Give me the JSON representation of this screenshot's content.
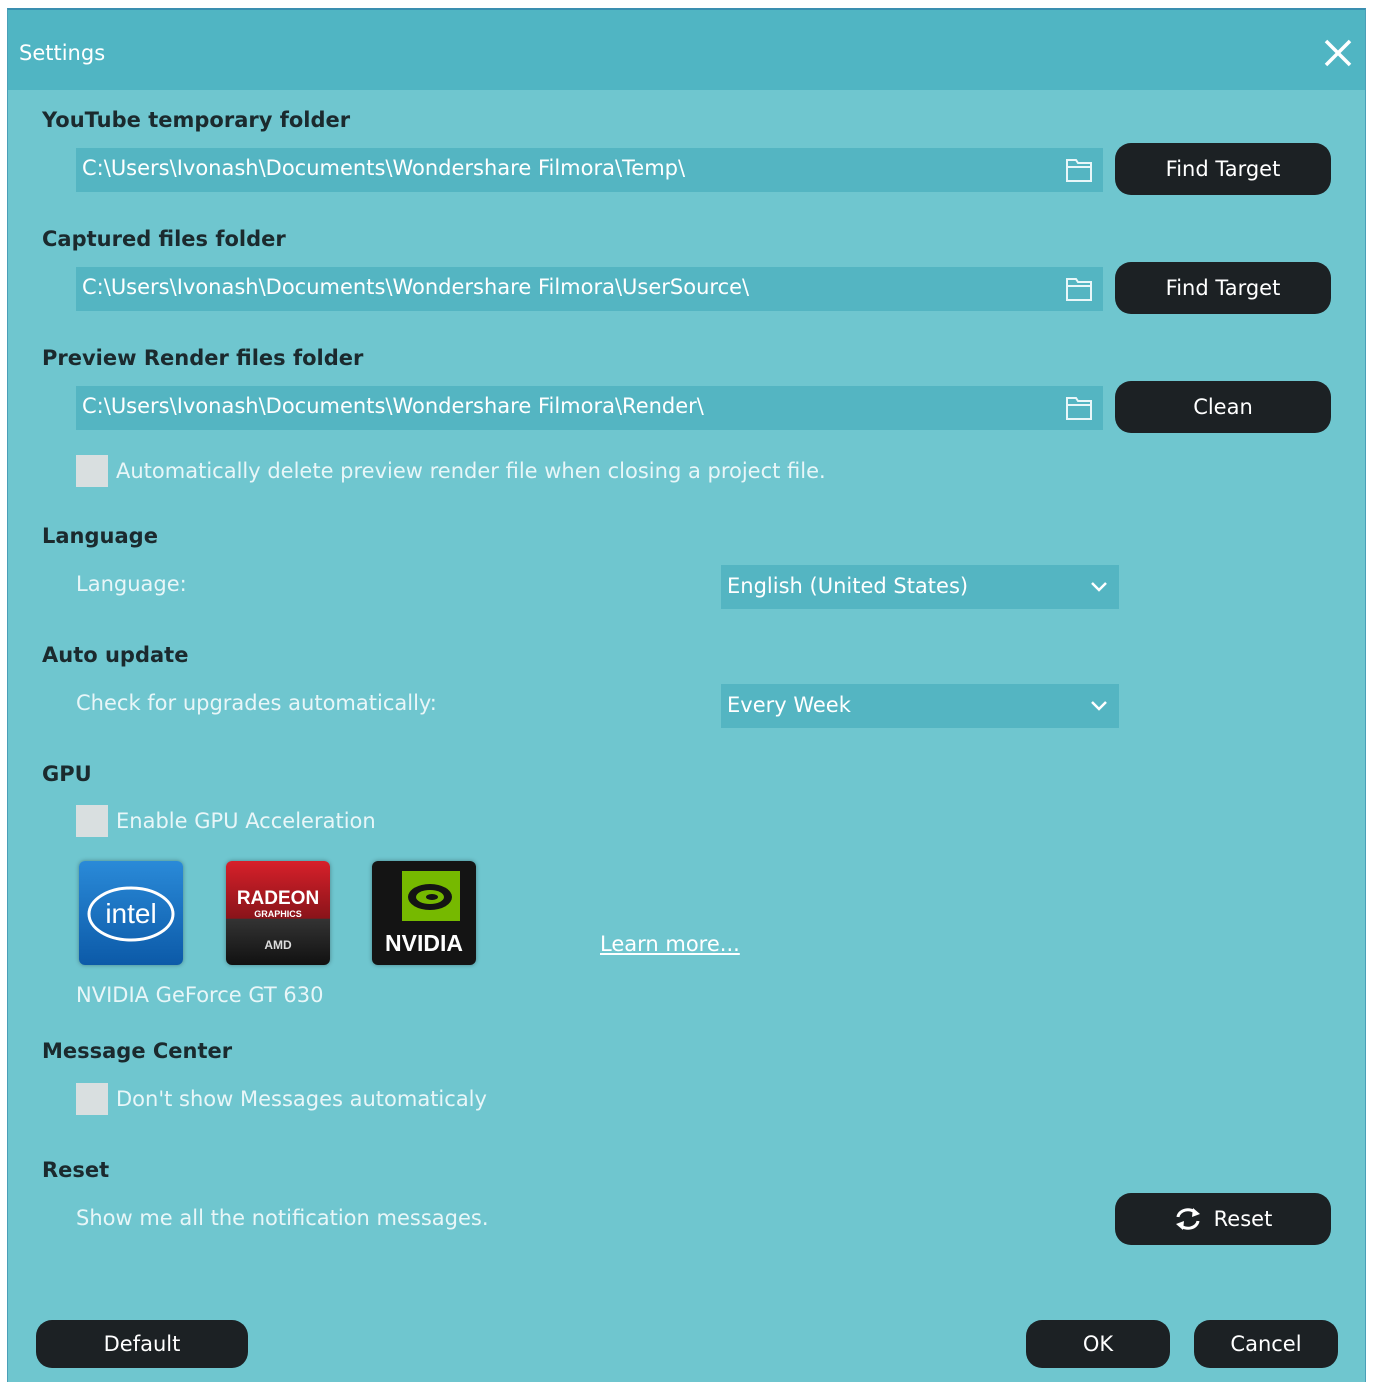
{
  "window": {
    "title": "Settings"
  },
  "youtube": {
    "heading": "YouTube temporary folder",
    "path": "C:\\Users\\Ivonash\\Documents\\Wondershare Filmora\\Temp\\",
    "button": "Find Target"
  },
  "captured": {
    "heading": "Captured files folder",
    "path": "C:\\Users\\Ivonash\\Documents\\Wondershare Filmora\\UserSource\\",
    "button": "Find Target"
  },
  "render": {
    "heading": "Preview Render files folder",
    "path": "C:\\Users\\Ivonash\\Documents\\Wondershare Filmora\\Render\\",
    "button": "Clean",
    "auto_delete_label": "Automatically delete preview render file when closing a project file.",
    "auto_delete_checked": false
  },
  "language": {
    "heading": "Language",
    "label": "Language:",
    "selected": "English (United States)"
  },
  "auto_update": {
    "heading": "Auto update",
    "label": "Check for upgrades automatically:",
    "selected": "Every Week"
  },
  "gpu": {
    "heading": "GPU",
    "enable_label": "Enable GPU Acceleration",
    "enable_checked": false,
    "logos": [
      "intel",
      "RADEON GRAPHICS AMD",
      "NVIDIA"
    ],
    "learn_more": "Learn more...",
    "device": "NVIDIA GeForce GT 630"
  },
  "message_center": {
    "heading": "Message Center",
    "dont_show_label": "Don't show Messages automaticaly",
    "dont_show_checked": false
  },
  "reset": {
    "heading": "Reset",
    "label": "Show me all the notification messages.",
    "button": "Reset"
  },
  "footer": {
    "default": "Default",
    "ok": "OK",
    "cancel": "Cancel"
  },
  "colors": {
    "background": "#6fc6cf",
    "titlebar": "#50b5c3",
    "field": "#54b5c2",
    "button": "#1c2124"
  }
}
